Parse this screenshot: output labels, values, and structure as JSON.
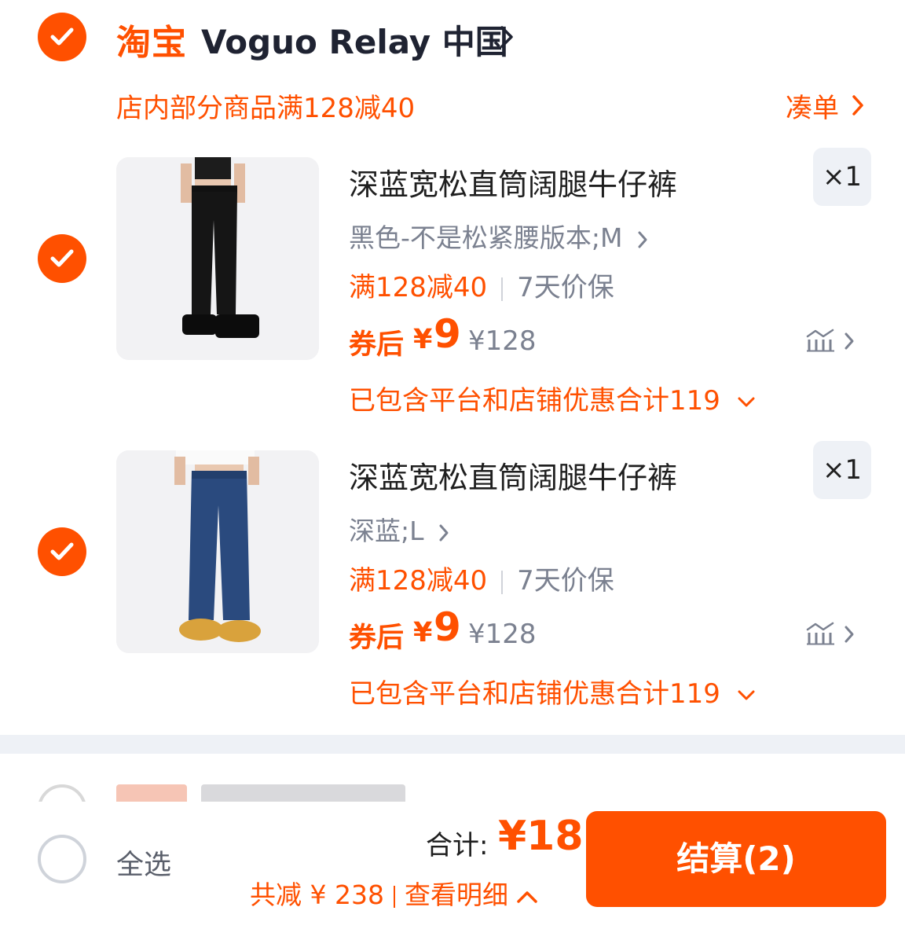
{
  "shop": {
    "logo_text": "淘宝",
    "name": "Voguo Relay 中国",
    "promo": "店内部分商品满128减40",
    "add_on_label": "凑单"
  },
  "items": [
    {
      "title": "深蓝宽松直筒阔腿牛仔裤",
      "quantity": "×1",
      "variant": "黑色-不是松紧腰版本;M",
      "discount": "满128减40",
      "guarantee": "7天价保",
      "after_coupon_label": "券后",
      "currency": "¥",
      "price": "9",
      "original_price": "¥128",
      "included_discount": "已包含平台和店铺优惠合计119",
      "image": "black-wide-leg-jeans"
    },
    {
      "title": "深蓝宽松直筒阔腿牛仔裤",
      "quantity": "×1",
      "variant": "深蓝;L",
      "discount": "满128减40",
      "guarantee": "7天价保",
      "after_coupon_label": "券后",
      "currency": "¥",
      "price": "9",
      "original_price": "¥128",
      "included_discount": "已包含平台和店铺优惠合计119",
      "image": "blue-wide-leg-jeans"
    }
  ],
  "footer": {
    "select_all_label": "全选",
    "total_label": "合计:",
    "total_value": "¥18",
    "savings": "共减 ¥ 238",
    "details_link": "查看明细",
    "checkout_label": "结算(2)"
  },
  "colors": {
    "accent": "#ff5000",
    "muted": "#7b8190",
    "qty_bg": "#eef1f6"
  },
  "icons": [
    "check-icon",
    "chevron-right-icon",
    "chevron-down-icon",
    "chevron-up-icon",
    "price-trend-icon"
  ]
}
